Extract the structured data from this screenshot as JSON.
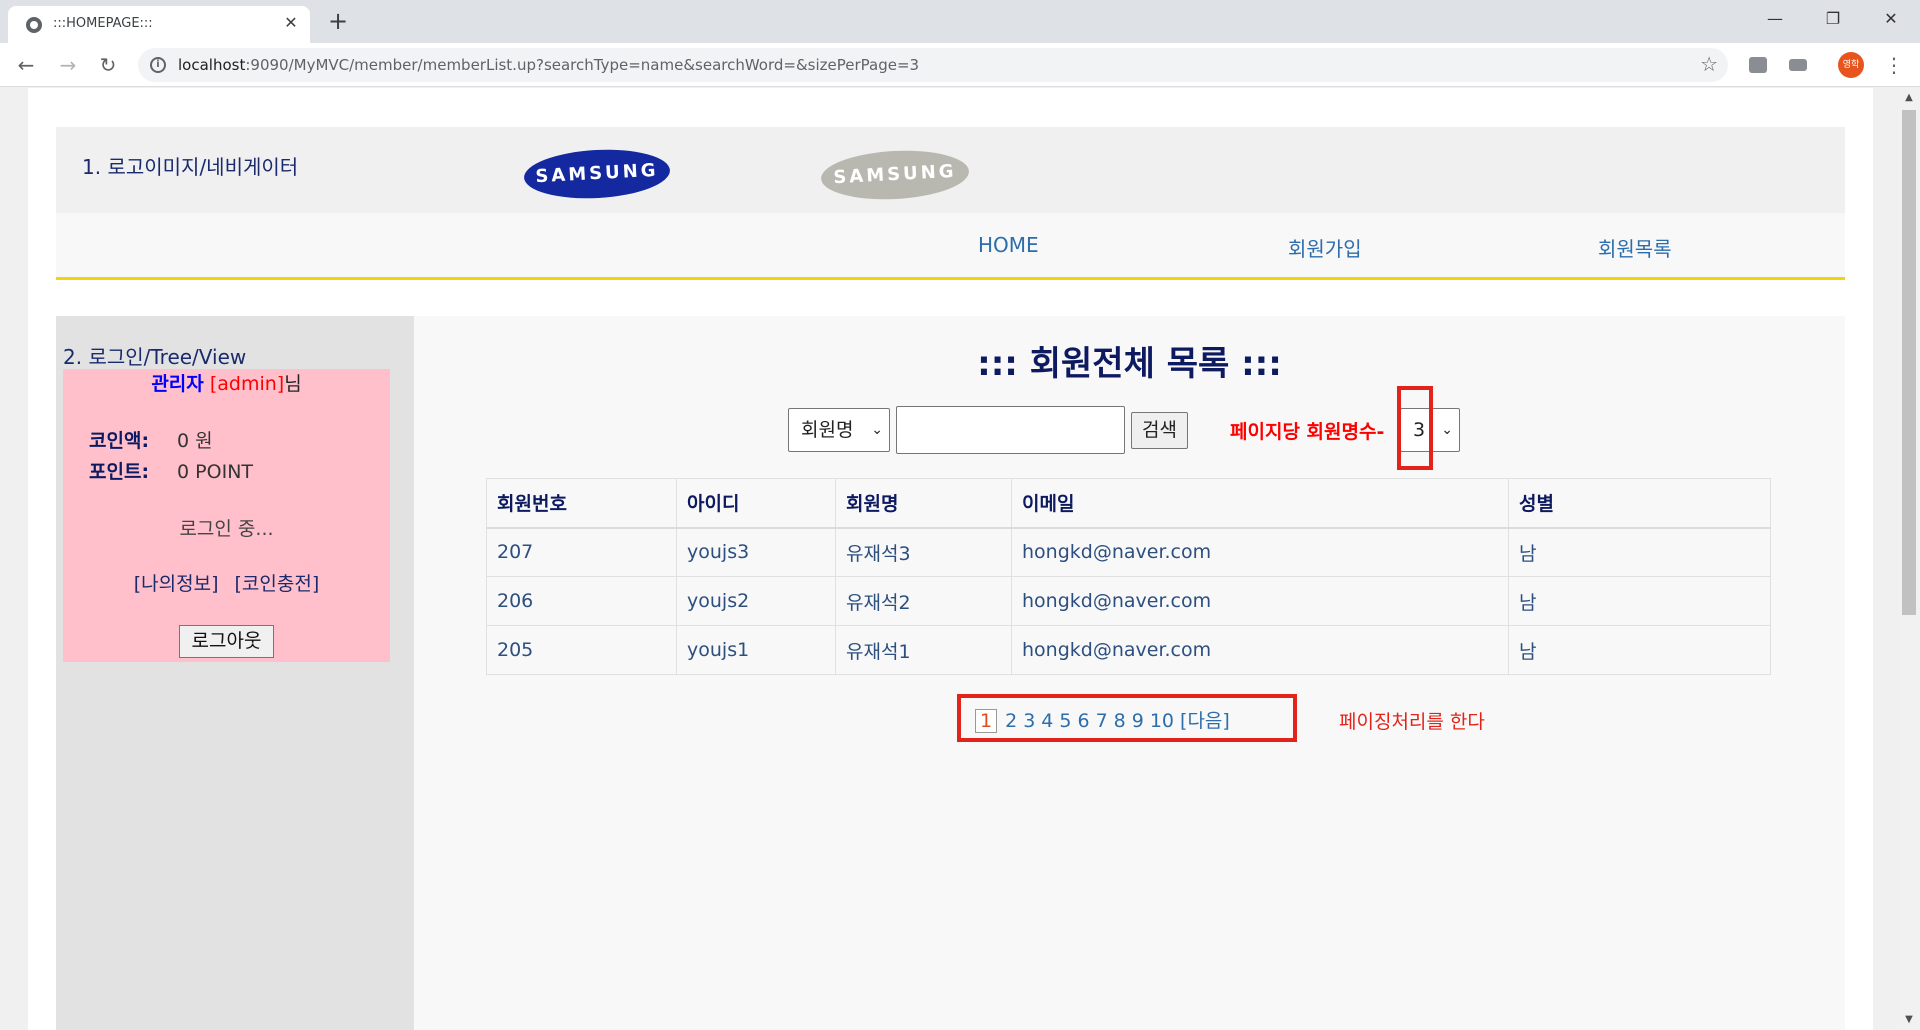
{
  "browser": {
    "tab_title": ":::HOMEPAGE:::",
    "tab_close": "✕",
    "new_tab": "+",
    "url_host": "localhost",
    "url_path": ":9090/MyMVC/member/memberList.up?searchType=name&searchWord=&sizePerPage=3",
    "profile_initials": "영학",
    "minimize": "—",
    "restore": "❐",
    "close": "✕"
  },
  "header": {
    "label": "1. 로고이미지/네비게이터",
    "logo1_text": "SAMSUNG",
    "logo2_text": "SAMSUNG"
  },
  "menu": {
    "items": [
      "HOME",
      "회원가입",
      "회원목록"
    ]
  },
  "sidebar": {
    "title": "2. 로그인/Tree/View",
    "role": "관리자",
    "user_id": "[admin]",
    "suffix": "님",
    "coin_label": "코인액:",
    "coin_value": "0 원",
    "point_label": "포인트:",
    "point_value": "0 POINT",
    "status": "로그인 중...",
    "link_myinfo": "[나의정보]",
    "link_coin": "[코인충전]",
    "logout": "로그아웃"
  },
  "content": {
    "title": "::: 회원전체 목록 :::",
    "search_type": "회원명",
    "search_word": "",
    "search_button": "검색",
    "perpage_label": "페이지당 회원명수-",
    "perpage_value": "3",
    "columns": [
      "회원번호",
      "아이디",
      "회원명",
      "이메일",
      "성별"
    ],
    "rows": [
      [
        "207",
        "youjs3",
        "유재석3",
        "hongkd@naver.com",
        "남"
      ],
      [
        "206",
        "youjs2",
        "유재석2",
        "hongkd@naver.com",
        "남"
      ],
      [
        "205",
        "youjs1",
        "유재석1",
        "hongkd@naver.com",
        "남"
      ]
    ],
    "pagination": {
      "current": "1",
      "pages": [
        "2",
        "3",
        "4",
        "5",
        "6",
        "7",
        "8",
        "9",
        "10"
      ],
      "next": "[다음]"
    },
    "pager_note": "페이징처리를 한다"
  }
}
